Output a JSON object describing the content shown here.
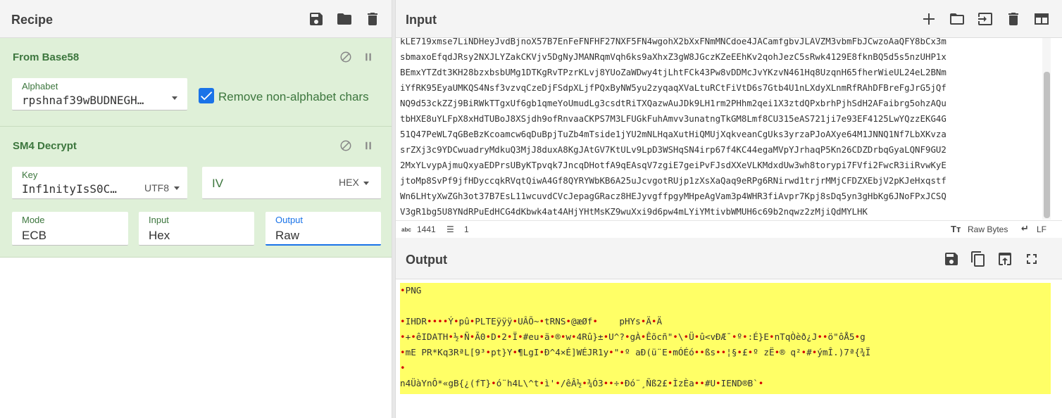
{
  "recipe": {
    "title": "Recipe",
    "operations": [
      {
        "name": "From Base58",
        "alphabet_label": "Alphabet",
        "alphabet_value": "rpshnaf39wBUDNEGH…",
        "remove_label": "Remove non-alphabet chars",
        "remove_checked": true
      },
      {
        "name": "SM4 Decrypt",
        "key_label": "Key",
        "key_value": "Inf1nityIsS0C…",
        "key_encoding": "UTF8",
        "iv_placeholder": "IV",
        "iv_encoding": "HEX",
        "mode_label": "Mode",
        "mode_value": "ECB",
        "input_label": "Input",
        "input_value": "Hex",
        "output_label": "Output",
        "output_value": "Raw"
      }
    ]
  },
  "input": {
    "title": "Input",
    "text_lines": [
      "kLE719xmse7LiNDHeyJvdBjnoX57B7EnFeFNFHF27NXF5FN4wgohX2bXxFNmMNCdoe4JACamfgbvJLAVZM3vbmFbJCwzoAaQFY8bCx3m",
      "sbmaxoEfqdJRsy2NXJLYZakCKVjv5DgNyJMANRqmVqh6ks9aXhxZ3gW8JGczKZeEEhKv2qohJezC5sRwk4129E8fknBQ5d5s5nzUHP1x",
      "BEmxYTZdt3KH28bzxbsbUMg1DTKgRvTPzrKLvj8YUoZaWDwy4tjLhtFCk43Pw8vDDMcJvYKzvN461Hq8UzqnH65fherWieUL24eL2BNm",
      "iYfRK95EyaUMKQS4Nsf3vzvqCzeDjFSdpXLjfPQxByNW5yu2zyqaqXVaLtuRCtFiVtD6s7Gtb4U1nLXdyXLnmRfRAhDFBreFgJrG5jQf",
      "NQ9d53ckZZj9BiRWkTTgxUf6gb1qmeYoUmudLg3csdtRiTXQazwAuJDk9LH1rm2PHhm2qei1X3ztdQPxbrhPjhSdH2AFaibrg5ohzAQu",
      "tbHXE8uYLFpX8xHdTUBoJ8XSjdh9ofRnvaaCKPS7M3LFUGkFuhAmvv3unatngTkGM8Lmf8CU315eAS721ji7e93EF4125LwYQzzEKG4G",
      "51Q47PeWL7qGBeBzKcoamcw6qDuBpjTuZb4mTside1jYU2mNLHqaXutHiQMUjXqkveanCgUks3yrzaPJoAXye64M1JNNQ1Nf7LbXKvza",
      "srZXj3c9YDCwuadryMdkuQ3MjJ8duxA8KgJAtGV7KtULv9LpD3WSHqSN4irp67f4KC44egaMVpYJrhaqP5Kn26CDZDrbqGyaLQNF9GU2",
      "2MxYLvypAjmuQxyaEDPrsUByKTpvqk7JncqDHotfA9qEAsqV7zgiE7geiPvFJsdXXeVLKMdxdUw3wh8torypi7FVfi2FwcR3iiRvwKyE",
      "jtoMp8SvPf9jfHDyccqkRVqtQiwA4Gf8QYRYWbKB6A25uJcvgotRUjp1zXsXaQaq9eRPg6RNirwd1trjrMMjCFDZXEbjV2pKJeHxqstf",
      "Wn6LHtyXwZGh3ot37B7EsL11wcuvdCVcJepagGRacz8HEJyvgffpgyMHpeAgVam3p4WHR3fiAvpr7Kpj8sDq5yn3gHbKg6JNoFPxJCSQ",
      "V3gR1bg5U8YNdRPuEdHCG4dKbwk4at4AHjYHtMsKZ9wuXxi9d6pw4mLYiYMtivbWMUH6c69b2nqwz2zMjiQdMYLHK"
    ],
    "char_count": "1441",
    "line_count": "1",
    "encoding_label": "Raw Bytes",
    "eol_label": "LF"
  },
  "output": {
    "title": "Output",
    "lines": [
      "•PNG",
      "",
      "•IHDR••••Ý•pû•PLTEÿÿÿ•UÂÕ~•tRNS•@æØf•    pHYs•Ä•Ä",
      "•+•êIDATH•½•Ñ•Ã0•D•2•Ï•#eu•ä•®•w•4Rû}±•U^?•gÀ•Êõcñ\"•\\•Ü•û<vÐÆ¯•º•:É}E•nTqÒèð¿J••ö\"ôÅ5•g",
      "•mE PR*Kq3RªL[9³•pt}Y•¶LgI•Ð^4×É]WÉJR1y•\"•º aÐ(ü¨E•mÓÉó••ßs••¦§•£•º zË•® q²•#•ýmÎ.)7ª{¾Ï",
      "•",
      "n4ÜàYnÔ*«gB{¿(fT}•ó¨h4L\\^t•ì'•/êÂ½•¾Ó3••÷•Ðó¨¸Ñß2£•ÌzÈa••#U•IEND®B`•"
    ]
  },
  "icons": {
    "recipe": [
      "save-icon",
      "folder-icon",
      "trash-icon"
    ],
    "input": [
      "plus-icon",
      "folder-icon",
      "import-icon",
      "trash-icon",
      "layout-icon"
    ],
    "output": [
      "save-icon",
      "copy-icon",
      "replace-input-icon",
      "maximize-icon"
    ],
    "operation": [
      "disable-icon",
      "pause-icon"
    ]
  }
}
